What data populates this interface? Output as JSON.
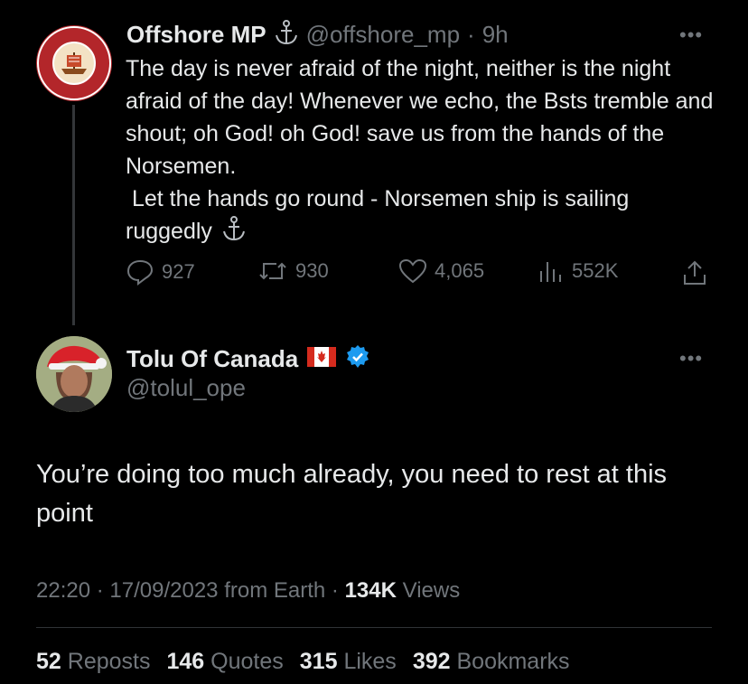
{
  "parent_tweet": {
    "display_name": "Offshore MP",
    "name_icon": "anchor-icon",
    "handle": "@offshore_mp",
    "separator": "·",
    "time": "9h",
    "text": "The day is never afraid of the night, neither is the night afraid of the day! Whenever we echo, the Bsts tremble and shout; oh God! oh God! save us from the hands of the Norsemen.\n Let the hands go round - Norsemen ship is sailing ruggedly",
    "text_trailing_icon": "anchor-icon",
    "avatar_logo_text_top": "OFFSHORE MARINE PATROL",
    "avatar_logo_text_bottom": "SERVICE TO HUMANITY",
    "actions": {
      "replies": "927",
      "reposts": "930",
      "likes": "4,065",
      "views": "552K"
    }
  },
  "reply_tweet": {
    "display_name": "Tolu Of Canada",
    "flag": "canada-flag-icon",
    "verified": "verified-badge-icon",
    "handle": "@tolul_ope",
    "text": "You’re doing too much already, you need to rest at this point",
    "time": "22:20",
    "date": "17/09/2023",
    "source": "from Earth",
    "views_count": "134K",
    "views_label": "Views",
    "sep": "·"
  },
  "stats": {
    "reposts_count": "52",
    "reposts_label": "Reposts",
    "quotes_count": "146",
    "quotes_label": "Quotes",
    "likes_count": "315",
    "likes_label": "Likes",
    "bookmarks_count": "392",
    "bookmarks_label": "Bookmarks"
  },
  "colors": {
    "background": "#000000",
    "text": "#e7e9ea",
    "muted": "#71767b",
    "verified": "#1d9bf0",
    "avatar_logo": "#b3262a"
  }
}
